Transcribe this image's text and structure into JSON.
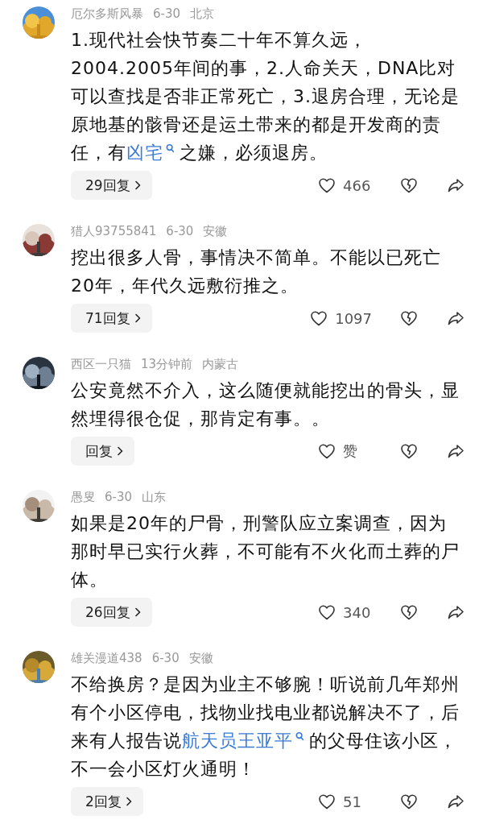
{
  "comments": [
    {
      "author": "厄尔多斯风暴",
      "time": "6-30",
      "location": "北京",
      "body": [
        {
          "kind": "text",
          "text": "1.现代社会快节奏二十年不算久远，2004.2005年间的事，2.人命关天，DNA比对可以查找是否非正常死亡，3.退房合理，无论是原地基的骸骨还是运土带来的都是开发商的责任，有"
        },
        {
          "kind": "link",
          "text": "凶宅"
        },
        {
          "kind": "text",
          "text": "之嫌，必须退房。"
        }
      ],
      "replies": "29回复",
      "likes": "466"
    },
    {
      "author": "猎人93755841",
      "time": "6-30",
      "location": "安徽",
      "body": [
        {
          "kind": "text",
          "text": "挖出很多人骨，事情决不简单。不能以已死亡20年，年代久远敷衍推之。"
        }
      ],
      "replies": "71回复",
      "likes": "1097"
    },
    {
      "author": "西区一只猫",
      "time": "13分钟前",
      "location": "内蒙古",
      "body": [
        {
          "kind": "text",
          "text": "公安竟然不介入，这么随便就能挖出的骨头，显然埋得很仓促，那肯定有事。。"
        }
      ],
      "replies": "回复",
      "likes": "赞"
    },
    {
      "author": "愚叟",
      "time": "6-30",
      "location": "山东",
      "body": [
        {
          "kind": "text",
          "text": "如果是20年的尸骨，刑警队应立案调查，因为那时早已实行火葬，不可能有不火化而土葬的尸体。"
        }
      ],
      "replies": "26回复",
      "likes": "340"
    },
    {
      "author": "雄关漫道438",
      "time": "6-30",
      "location": "安徽",
      "body": [
        {
          "kind": "text",
          "text": "不给换房？是因为业主不够腕！听说前几年郑州有个小区停电，找物业找电业都说解决不了，后来有人报告说"
        },
        {
          "kind": "link",
          "text": "航天员王亚平"
        },
        {
          "kind": "text",
          "text": "的父母住该小区，不一会小区灯火通明！"
        }
      ],
      "replies": "2回复",
      "likes": "51"
    }
  ]
}
